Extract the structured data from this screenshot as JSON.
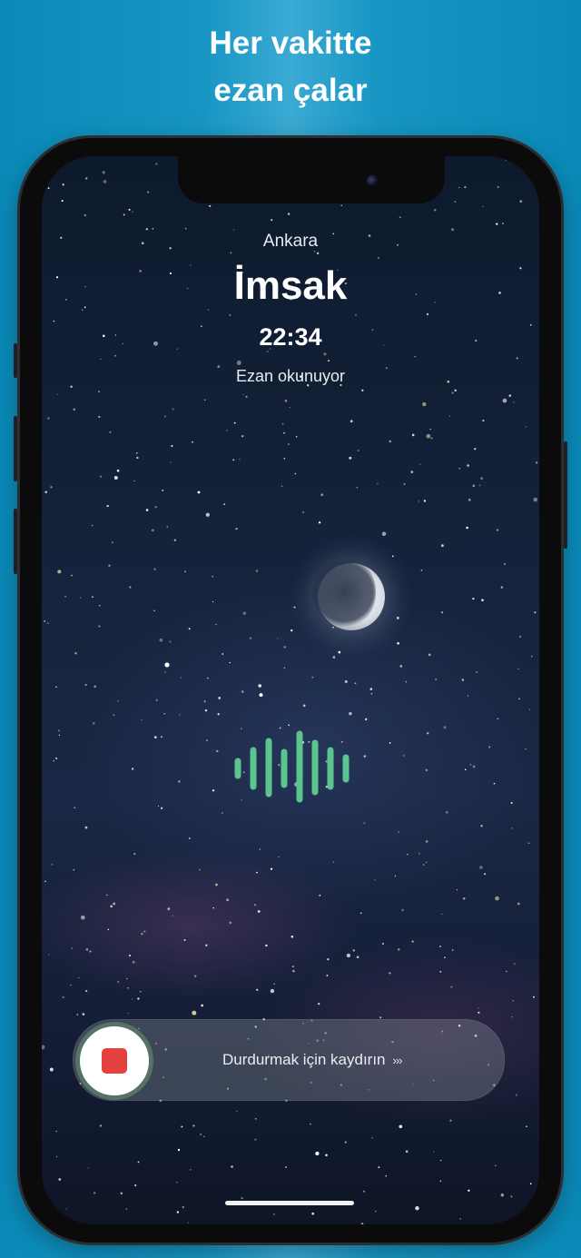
{
  "promo": {
    "headline_line1": "Her vakitte",
    "headline_line2": "ezan çalar"
  },
  "alarm": {
    "city": "Ankara",
    "prayer_name": "İmsak",
    "time": "22:34",
    "status": "Ezan okunuyor"
  },
  "slider": {
    "label": "Durdurmak için kaydırın",
    "chevrons": "›››"
  },
  "colors": {
    "background_blue": "#1796c4",
    "wave_green": "#5cc48e",
    "stop_red": "#e5403e",
    "stop_ring": "#557267"
  },
  "icons": {
    "stop": "stop-square-icon",
    "wave": "audio-wave-icon",
    "moon": "moon-icon"
  }
}
